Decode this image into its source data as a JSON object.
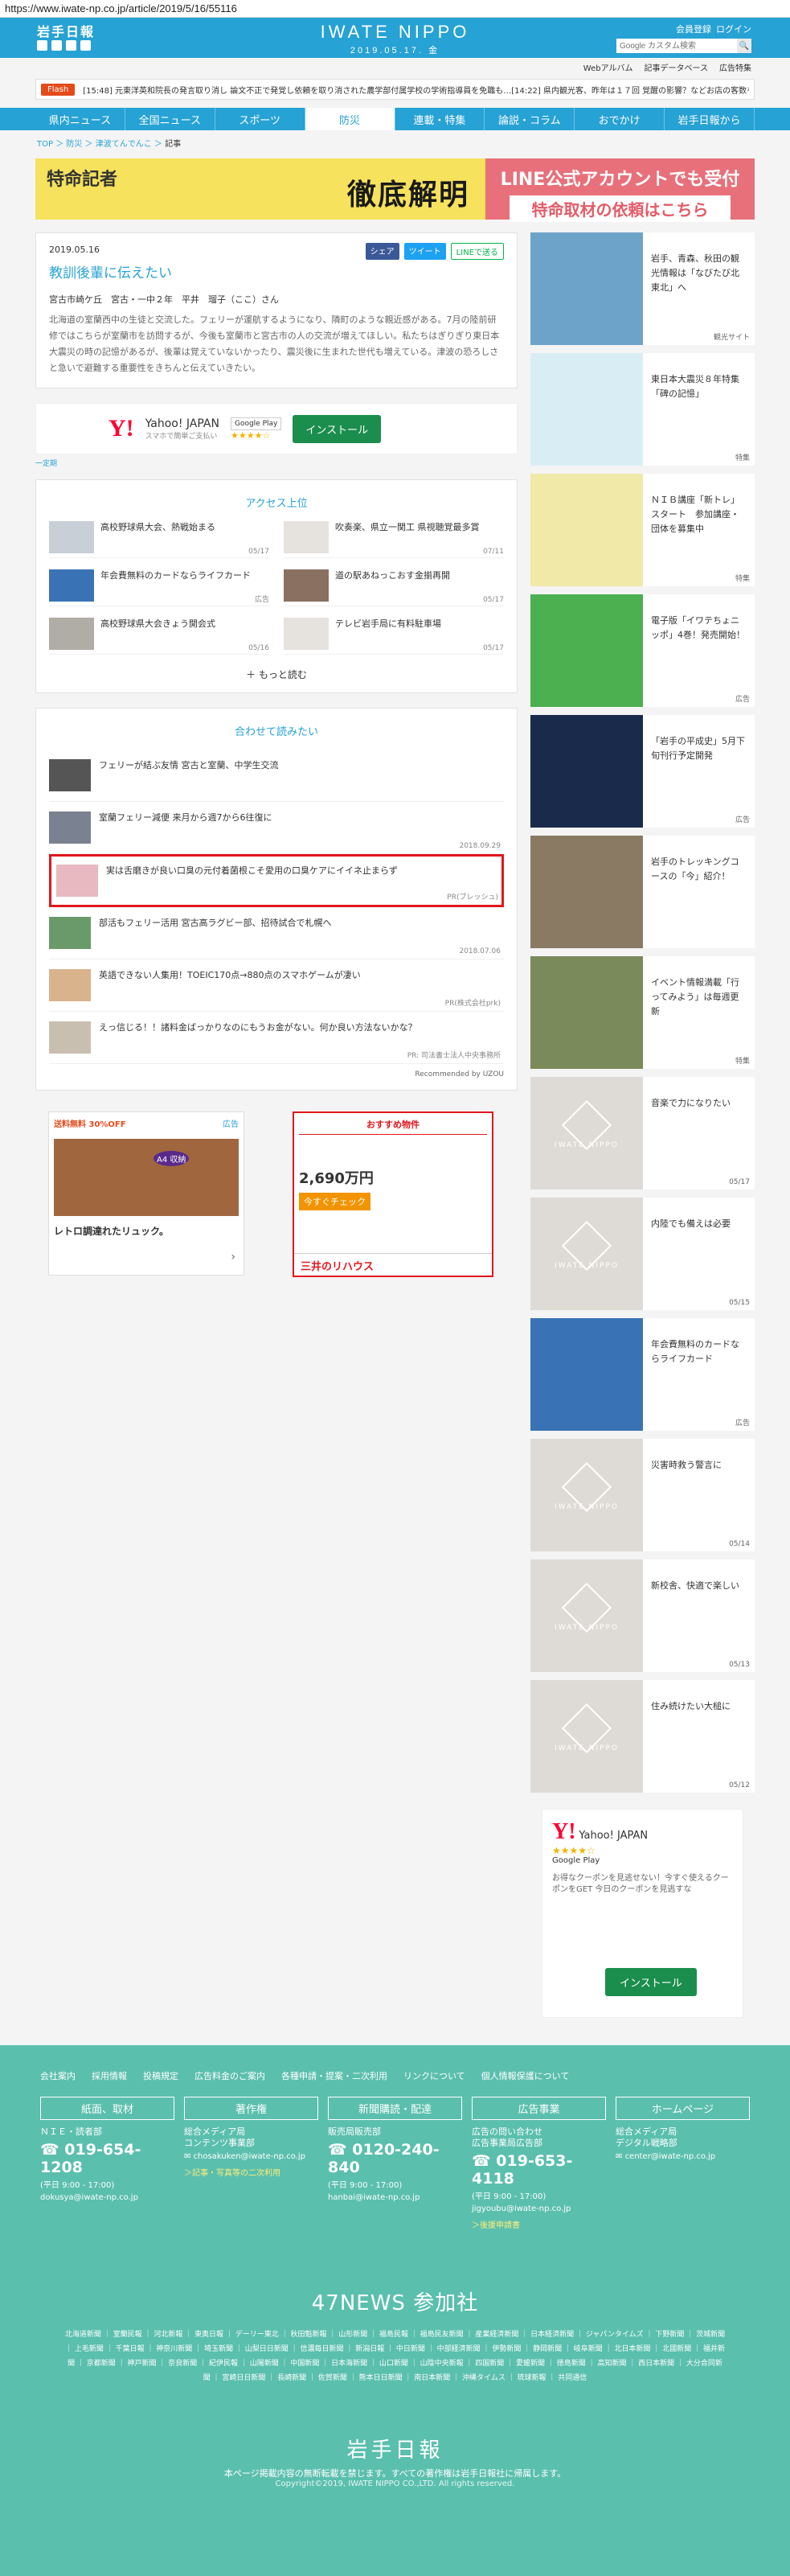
{
  "url": "https://www.iwate-np.co.jp/article/2019/5/16/55116",
  "header": {
    "logo": "岩手日報",
    "brand": "IWATE NIPPO",
    "date": "2019.05.17. 金",
    "links": [
      "会員登録",
      "ログイン"
    ],
    "search_placeholder": "Google カスタム検索"
  },
  "subbar": [
    "Webアルバム",
    "記事データベース",
    "広告特集"
  ],
  "flash": {
    "tag": "Flash",
    "text": "[15:48] 元東洋英和院長の発言取り消し 論文不正で発覚し依頼を取り消された農学部付属学校の学術指導員を免職も…[14:22] 県内観光客、昨年は１７回 覚醒の影響？などお店の客数を外…"
  },
  "nav": [
    "県内ニュース",
    "全国ニュース",
    "スポーツ",
    "防災",
    "連載・特集",
    "論説・コラム",
    "おでかけ",
    "岩手日報から"
  ],
  "breadcrumb": [
    "TOP",
    "防災",
    "津波てんでんこ",
    "記事"
  ],
  "banner": {
    "left_title": "特命記者",
    "left_main": "徹底解明",
    "right_1": "LINE公式アカウントでも受付",
    "right_2": "特命取材の依頼はこちら"
  },
  "article": {
    "date": "2019.05.16",
    "share": [
      "シェア",
      "ツイート",
      "LINEで送る"
    ],
    "title": "教訓後輩に伝えたい",
    "author": "宮古市崎ケ丘　宮古・一中２年　平井　瑠子（ここ）さん",
    "body": "北海道の室蘭西中の生徒と交流した。フェリーが運航するようになり、隣町のような親近感がある。7月の陸前研修ではこちらが室蘭市を訪問するが、今後も室蘭市と宮古市の人の交流が増えてほしい。私たちはぎりぎり東日本大震災の時の記憶があるが、後輩は覚えていないかったり、震災後に生まれた世代も増えている。津波の恐ろしさと急いで避難する重要性をきちんと伝えていきたい。"
  },
  "app_ad": {
    "logo": "Y!",
    "name": "Yahoo! JAPAN",
    "sub": "スマホで簡単ご支払い",
    "store": "Google Play",
    "stars": "★★★★☆",
    "install": "インストール",
    "label": "一定期"
  },
  "ranking": {
    "title": "アクセス上位",
    "items": [
      {
        "text": "高校野球県大会、熱戦始まる",
        "date": "05/17"
      },
      {
        "text": "吹奏楽、県立一関工 県視聴覚最多賞",
        "date": "07/11"
      },
      {
        "text": "年会費無料のカードならライフカード",
        "date": "広告"
      },
      {
        "text": "道の駅あねっこおす金揃再開",
        "date": "05/17"
      },
      {
        "text": "高校野球県大会きょう開会式",
        "date": "05/16"
      },
      {
        "text": "テレビ岩手局に有料駐車場",
        "date": "05/17"
      }
    ],
    "more": "もっと読む"
  },
  "recommend": {
    "title": "合わせて読みたい",
    "items": [
      {
        "text": "フェリーが結ぶ友情 宮古と室蘭、中学生交流",
        "meta": ""
      },
      {
        "text": "室蘭フェリー減便 来月から週7から6往復に",
        "meta": "2018.09.29"
      },
      {
        "text": "実は舌磨きが良い口臭の元付着菌根こそ愛用の口臭ケアにイイネ止まらず",
        "meta": "PR(ブレッシュ)"
      },
      {
        "text": "部活もフェリー活用 宮古高ラグビー部、招待試合で札幌へ",
        "meta": "2018.07.06"
      },
      {
        "text": "英語できない人集用！TOEIC170点→880点のスマホゲームが凄い",
        "meta": "PR(株式会社prk)"
      },
      {
        "text": "えっ信じる！！諸料金ばっかりなのにもうお金がない。何か良い方法ないかな？",
        "meta": "PR: 司法書士法人中央事務所"
      }
    ],
    "powered": "Recommended by UZOU"
  },
  "ad_backpack": {
    "label": "送料無料 30%OFF",
    "badge": "A4 収納",
    "caption": "レトロ調達れたリュック。",
    "tag": "広告"
  },
  "ad_house": {
    "title": "おすすめ物件",
    "price": "2,690万円",
    "cta": "今すぐチェック",
    "foot": "三井のリハウス"
  },
  "sidebar": {
    "items": [
      {
        "text": "岩手、青森、秋田の観光情報は「なびたび北東北」へ",
        "tag": "観光サイト",
        "color": "#6ea3c9"
      },
      {
        "text": "東日本大震災８年特集「碑の記憶」",
        "tag": "特集",
        "color": "#e4f1f8"
      },
      {
        "text": "ＮＩＢ講座「新トレ」スタート　参加講座・団体を募集中",
        "tag": "特集",
        "color": "#8bc34a"
      },
      {
        "text": "電子版「イワテちょニッポ」4巻！発売開始！",
        "tag": "広告",
        "color": "#4caf50"
      },
      {
        "text": "「岩手の平成史」5月下旬刊行予定開発",
        "tag": "広告",
        "color": "#1a2a4a"
      },
      {
        "text": "岩手のトレッキングコースの「今」紹介！",
        "tag": "",
        "color": "#8a7a64"
      },
      {
        "text": "イベント情報満載「行ってみよう」は毎週更新",
        "tag": "特集",
        "color": "#7a8a5a"
      },
      {
        "text": "音楽で力になりたい",
        "tag": "05/17",
        "color": ""
      },
      {
        "text": "内陸でも備えは必要",
        "tag": "05/15",
        "color": ""
      },
      {
        "text": "年会費無料のカードならライフカード",
        "tag": "広告",
        "color": "#3a73b5"
      },
      {
        "text": "災害時救う警言に",
        "tag": "05/14",
        "color": ""
      },
      {
        "text": "新校舎、快適で楽しい",
        "tag": "05/13",
        "color": ""
      },
      {
        "text": "住み続けたい大槌に",
        "tag": "05/12",
        "color": ""
      }
    ],
    "app": {
      "logo": "Y!",
      "name": "Yahoo! JAPAN",
      "stars": "★★★★☆",
      "store": "Google Play",
      "copy": "お得なクーポンを見逃せない！今すぐ使えるクーポンをGET 今日のクーポンを見逃すな",
      "install": "インストール"
    }
  },
  "footer": {
    "links": [
      "会社案内",
      "採用情報",
      "投稿規定",
      "広告料金のご案内",
      "各種申請・提案・二次利用",
      "リンクについて",
      "個人情報保護について"
    ],
    "cols": [
      {
        "head": "紙面、取材",
        "lines": [
          "ＮＩＥ・読者部"
        ],
        "phone": "019-654-1208",
        "hours": "(平日 9:00 - 17:00)",
        "mail": "dokusya@iwate-np.co.jp",
        "link": ""
      },
      {
        "head": "著作権",
        "lines": [
          "総合メディア局",
          "コンテンツ事業部"
        ],
        "phone": "",
        "hours": "",
        "mail": "chosakuken@iwate-np.co.jp",
        "link": "＞記事・写真等の二次利用"
      },
      {
        "head": "新聞購読・配達",
        "lines": [
          "販売局販売部"
        ],
        "phone": "0120-240-840",
        "hours": "(平日 9:00 - 17:00)",
        "mail": "hanbai@iwate-np.co.jp",
        "link": ""
      },
      {
        "head": "広告事業",
        "lines": [
          "広告の問い合わせ",
          "広告事業局広告部"
        ],
        "phone": "019-653-4118",
        "hours": "(平日 9:00 - 17:00)",
        "mail": "jigyoubu@iwate-np.co.jp",
        "link": "＞後援申請書"
      },
      {
        "head": "ホームページ",
        "lines": [
          "総合メディア局",
          "デジタル戦略部"
        ],
        "phone": "",
        "hours": "",
        "mail": "center@iwate-np.co.jp",
        "link": ""
      }
    ],
    "news47": "47NEWS 参加社",
    "members": "北海道新聞 ｜ 室蘭民報 ｜ 河北新報 ｜ 東奥日報 ｜ デーリー東北 ｜ 秋田魁新報 ｜ 山形新聞 ｜ 福島民報 ｜ 福島民友新聞 ｜ 産業経済新聞 ｜ 日本経済新聞 ｜ ジャパンタイムズ ｜ 下野新聞 ｜ 茨城新聞 ｜ 上毛新聞 ｜ 千葉日報 ｜ 神奈川新聞 ｜ 埼玉新聞 ｜ 山梨日日新聞 ｜ 信濃毎日新聞 ｜ 新潟日報 ｜ 中日新聞 ｜ 中部経済新聞 ｜ 伊勢新聞 ｜ 静岡新聞 ｜ 岐阜新聞 ｜ 北日本新聞 ｜ 北國新聞 ｜ 福井新聞 ｜ 京都新聞 ｜ 神戸新聞 ｜ 奈良新聞 ｜ 紀伊民報 ｜ 山陽新聞 ｜ 中国新聞 ｜ 日本海新聞 ｜ 山口新聞 ｜ 山陰中央新報 ｜ 四国新聞 ｜ 愛媛新聞 ｜ 徳島新聞 ｜ 高知新聞 ｜ 西日本新聞 ｜ 大分合同新聞 ｜ 宮崎日日新聞 ｜ 長崎新聞 ｜ 佐賀新聞 ｜ 熊本日日新聞 ｜ 南日本新聞 ｜ 沖縄タイムス ｜ 琉球新報 ｜ 共同通信",
    "logo": "岩手日報",
    "notice": "本ページ掲載内容の無断転載を禁じます。すべての著作権は岩手日報社に帰属します。",
    "copyright": "Copyright©2019, IWATE NIPPO CO.,LTD. All rights reserved."
  }
}
